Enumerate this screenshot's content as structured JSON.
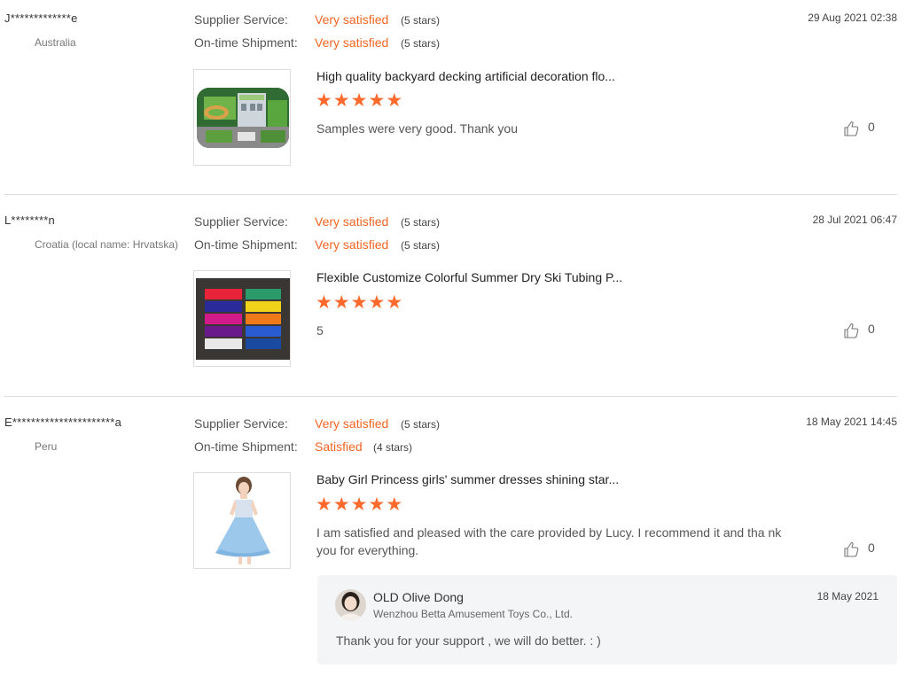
{
  "labels": {
    "supplier_service": "Supplier Service:",
    "ontime_shipment": "On-time Shipment:"
  },
  "colors": {
    "accent": "#f26522",
    "star": "#ff6a2c",
    "divider": "#dcdcdc",
    "reply_bg": "#f4f5f7"
  },
  "icons": {
    "like": "thumbs-up-icon",
    "star": "star-icon"
  },
  "reviews": [
    {
      "buyer": "J*************e",
      "country": "Australia",
      "date": "29 Aug 2021 02:38",
      "supplier_service": {
        "value": "Very satisfied",
        "stars_text": "(5 stars)"
      },
      "ontime_shipment": {
        "value": "Very satisfied",
        "stars_text": "(5 stars)"
      },
      "product_title": "High quality backyard decking artificial decoration flo...",
      "rating": 5,
      "comment": "Samples were very good. Thank you",
      "likes": "0"
    },
    {
      "buyer": "L********n",
      "country": "Croatia (local name: Hrvatska)",
      "date": "28 Jul 2021 06:47",
      "supplier_service": {
        "value": "Very satisfied",
        "stars_text": "(5 stars)"
      },
      "ontime_shipment": {
        "value": "Very satisfied",
        "stars_text": "(5 stars)"
      },
      "product_title": "Flexible Customize Colorful Summer Dry Ski Tubing P...",
      "rating": 5,
      "comment": "5",
      "likes": "0"
    },
    {
      "buyer": "E**********************a",
      "country": "Peru",
      "date": "18 May 2021 14:45",
      "supplier_service": {
        "value": "Very satisfied",
        "stars_text": "(5 stars)"
      },
      "ontime_shipment": {
        "value": "Satisfied",
        "stars_text": "(4 stars)"
      },
      "product_title": "Baby Girl Princess girls' summer dresses shining star...",
      "rating": 5,
      "comment": "I am satisfied and pleased with the care provided by Lucy. I recommend it and tha nk you for everything.",
      "likes": "0",
      "reply": {
        "name": "OLD Olive Dong",
        "company": "Wenzhou Betta Amusement Toys Co., Ltd.",
        "date": "18 May 2021",
        "text": "Thank you for your support , we will do better. : )"
      }
    }
  ]
}
